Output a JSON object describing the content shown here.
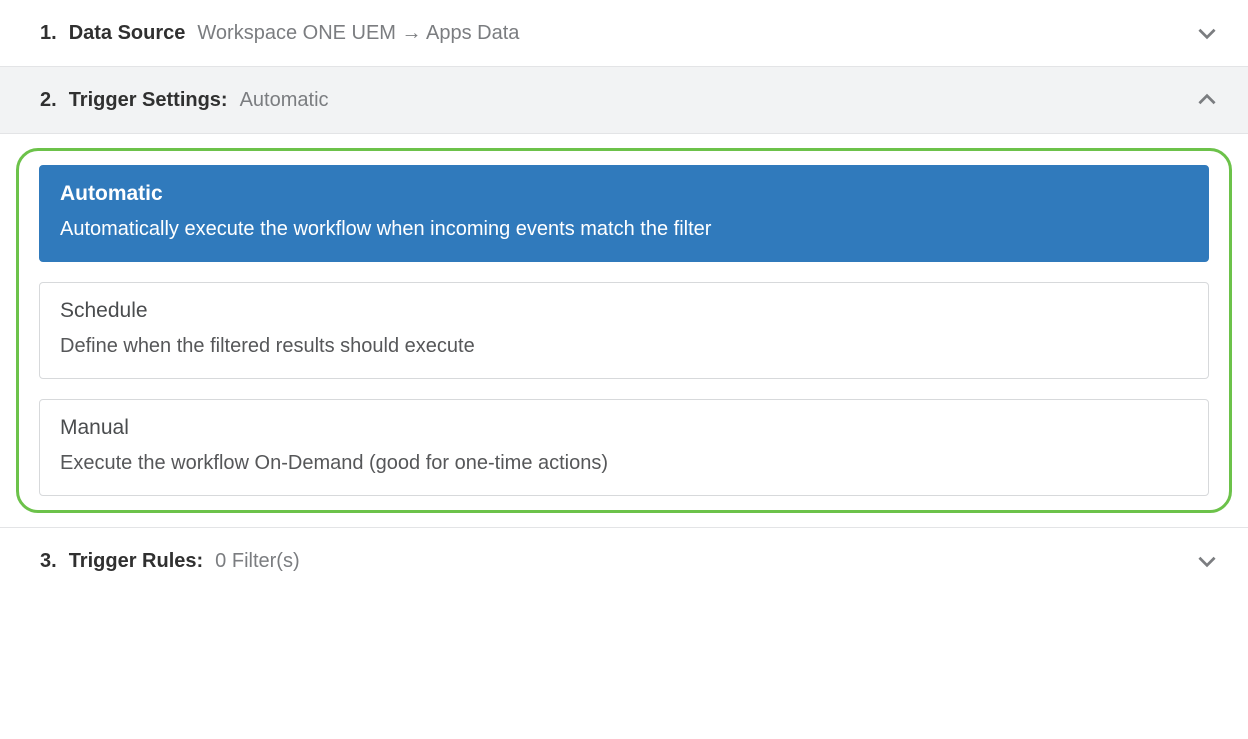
{
  "sections": {
    "dataSource": {
      "num": "1.",
      "title": "Data Source",
      "value": "Workspace ONE UEM → Apps Data"
    },
    "trigger": {
      "num": "2.",
      "title": "Trigger Settings:",
      "value": "Automatic"
    },
    "rules": {
      "num": "3.",
      "title": "Trigger Rules:",
      "value": "0 Filter(s)"
    }
  },
  "triggerOptions": {
    "automatic": {
      "title": "Automatic",
      "desc": "Automatically execute the workflow when incoming events match the filter"
    },
    "schedule": {
      "title": "Schedule",
      "desc": "Define when the filtered results should execute"
    },
    "manual": {
      "title": "Manual",
      "desc": "Execute the workflow On-Demand (good for one-time actions)"
    }
  }
}
